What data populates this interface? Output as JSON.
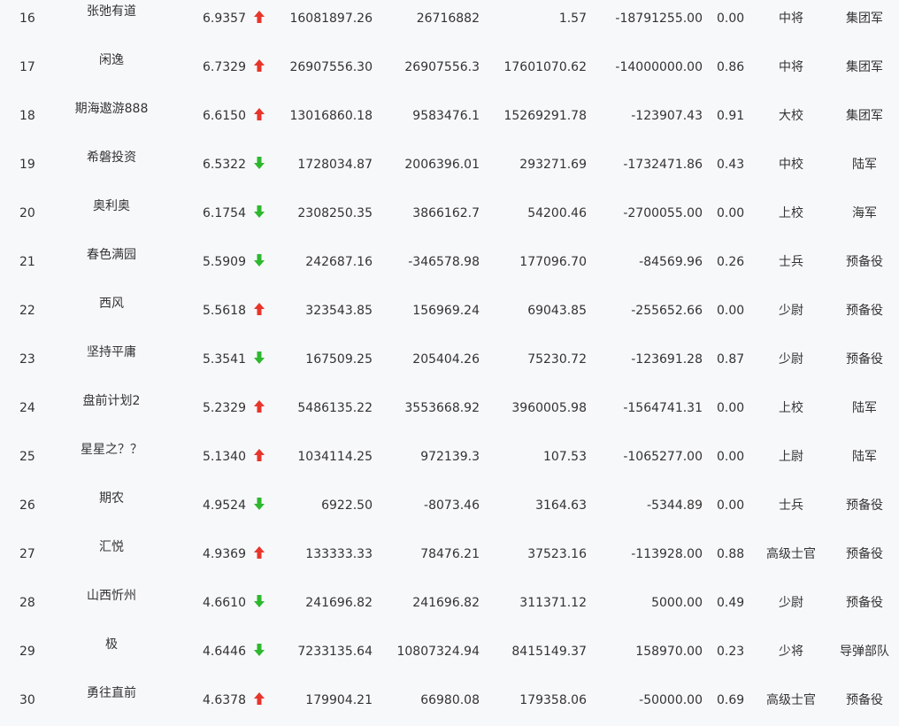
{
  "colors": {
    "up": "#e8352b",
    "down": "#2eb82e",
    "text": "#333333",
    "background": "#f7f8fa"
  },
  "rows": [
    {
      "rank": "16",
      "name": "张弛有道",
      "score": "6.9357",
      "trend": "up-arrow-icon",
      "v1": "16081897.26",
      "v2": "26716882",
      "v3": "1.57",
      "v4": "-18791255.00",
      "v5": "0.00",
      "rank_title": "中将",
      "corps": "集团军"
    },
    {
      "rank": "17",
      "name": "闲逸",
      "score": "6.7329",
      "trend": "up-arrow-icon",
      "v1": "26907556.30",
      "v2": "26907556.3",
      "v3": "17601070.62",
      "v4": "-14000000.00",
      "v5": "0.86",
      "rank_title": "中将",
      "corps": "集团军"
    },
    {
      "rank": "18",
      "name": "期海遨游888",
      "score": "6.6150",
      "trend": "up-arrow-icon",
      "v1": "13016860.18",
      "v2": "9583476.1",
      "v3": "15269291.78",
      "v4": "-123907.43",
      "v5": "0.91",
      "rank_title": "大校",
      "corps": "集团军"
    },
    {
      "rank": "19",
      "name": "希磐投资",
      "score": "6.5322",
      "trend": "down-arrow-icon",
      "v1": "1728034.87",
      "v2": "2006396.01",
      "v3": "293271.69",
      "v4": "-1732471.86",
      "v5": "0.43",
      "rank_title": "中校",
      "corps": "陆军"
    },
    {
      "rank": "20",
      "name": "奥利奥",
      "score": "6.1754",
      "trend": "down-arrow-icon",
      "v1": "2308250.35",
      "v2": "3866162.7",
      "v3": "54200.46",
      "v4": "-2700055.00",
      "v5": "0.00",
      "rank_title": "上校",
      "corps": "海军"
    },
    {
      "rank": "21",
      "name": "春色满园",
      "score": "5.5909",
      "trend": "down-arrow-icon",
      "v1": "242687.16",
      "v2": "-346578.98",
      "v3": "177096.70",
      "v4": "-84569.96",
      "v5": "0.26",
      "rank_title": "士兵",
      "corps": "预备役"
    },
    {
      "rank": "22",
      "name": "西风",
      "score": "5.5618",
      "trend": "up-arrow-icon",
      "v1": "323543.85",
      "v2": "156969.24",
      "v3": "69043.85",
      "v4": "-255652.66",
      "v5": "0.00",
      "rank_title": "少尉",
      "corps": "预备役"
    },
    {
      "rank": "23",
      "name": "坚持平庸",
      "score": "5.3541",
      "trend": "down-arrow-icon",
      "v1": "167509.25",
      "v2": "205404.26",
      "v3": "75230.72",
      "v4": "-123691.28",
      "v5": "0.87",
      "rank_title": "少尉",
      "corps": "预备役"
    },
    {
      "rank": "24",
      "name": "盘前计划2",
      "score": "5.2329",
      "trend": "up-arrow-icon",
      "v1": "5486135.22",
      "v2": "3553668.92",
      "v3": "3960005.98",
      "v4": "-1564741.31",
      "v5": "0.00",
      "rank_title": "上校",
      "corps": "陆军"
    },
    {
      "rank": "25",
      "name": "星星之？？",
      "score": "5.1340",
      "trend": "up-arrow-icon",
      "v1": "1034114.25",
      "v2": "972139.3",
      "v3": "107.53",
      "v4": "-1065277.00",
      "v5": "0.00",
      "rank_title": "上尉",
      "corps": "陆军"
    },
    {
      "rank": "26",
      "name": "期农",
      "score": "4.9524",
      "trend": "down-arrow-icon",
      "v1": "6922.50",
      "v2": "-8073.46",
      "v3": "3164.63",
      "v4": "-5344.89",
      "v5": "0.00",
      "rank_title": "士兵",
      "corps": "预备役"
    },
    {
      "rank": "27",
      "name": "汇悦",
      "score": "4.9369",
      "trend": "up-arrow-icon",
      "v1": "133333.33",
      "v2": "78476.21",
      "v3": "37523.16",
      "v4": "-113928.00",
      "v5": "0.88",
      "rank_title": "高级士官",
      "corps": "预备役"
    },
    {
      "rank": "28",
      "name": "山西忻州",
      "score": "4.6610",
      "trend": "down-arrow-icon",
      "v1": "241696.82",
      "v2": "241696.82",
      "v3": "311371.12",
      "v4": "5000.00",
      "v5": "0.49",
      "rank_title": "少尉",
      "corps": "预备役"
    },
    {
      "rank": "29",
      "name": "极",
      "score": "4.6446",
      "trend": "down-arrow-icon",
      "v1": "7233135.64",
      "v2": "10807324.94",
      "v3": "8415149.37",
      "v4": "158970.00",
      "v5": "0.23",
      "rank_title": "少将",
      "corps": "导弹部队"
    },
    {
      "rank": "30",
      "name": "勇往直前",
      "score": "4.6378",
      "trend": "up-arrow-icon",
      "v1": "179904.21",
      "v2": "66980.08",
      "v3": "179358.06",
      "v4": "-50000.00",
      "v5": "0.69",
      "rank_title": "高级士官",
      "corps": "预备役"
    }
  ]
}
